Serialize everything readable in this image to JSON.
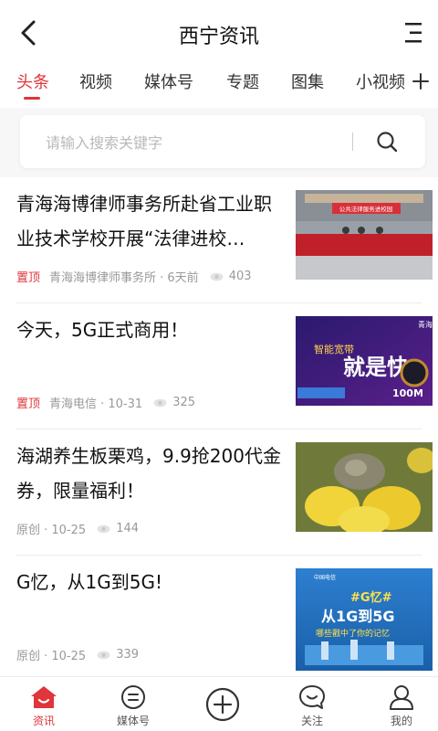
{
  "header": {
    "title": "西宁资讯"
  },
  "tabs": [
    {
      "label": "头条",
      "active": true
    },
    {
      "label": "视频"
    },
    {
      "label": "媒体号"
    },
    {
      "label": "专题"
    },
    {
      "label": "图集"
    },
    {
      "label": "小视频"
    }
  ],
  "search": {
    "placeholder": "请输入搜索关键字"
  },
  "feed": [
    {
      "headline": "青海海博律师事务所赴省工业职业技术学校开展“法律进校…",
      "tag": "置顶",
      "source": "青海海博律师事务所 · 6天前",
      "views": "403",
      "thumb_sign": "公共法律服务进校园"
    },
    {
      "headline": "今天，5G正式商用！",
      "tag": "置顶",
      "source": "青海电信 · 10-31",
      "views": "325",
      "thumb_text": [
        "智能宽带",
        "就是快",
        "100M",
        "青海"
      ]
    },
    {
      "headline": "海湖养生板栗鸡，9.9抢200代金券，限量福利！",
      "tag": "",
      "source": "原创 · 10-25",
      "views": "144"
    },
    {
      "headline": "G忆，从1G到5G!",
      "tag": "",
      "source": "原创 · 10-25",
      "views": "339",
      "thumb_text": [
        "#G忆#",
        "从1G到5G",
        "哪些戳中了你的记忆",
        "中国电信"
      ]
    }
  ],
  "bottom_nav": [
    {
      "label": "资讯",
      "icon": "home-icon",
      "active": true
    },
    {
      "label": "媒体号",
      "icon": "media-icon"
    },
    {
      "label": "",
      "icon": "add-icon"
    },
    {
      "label": "关注",
      "icon": "follow-icon"
    },
    {
      "label": "我的",
      "icon": "profile-icon"
    }
  ],
  "colors": {
    "accent": "#e0353a",
    "text": "#111111",
    "meta": "#999999"
  }
}
